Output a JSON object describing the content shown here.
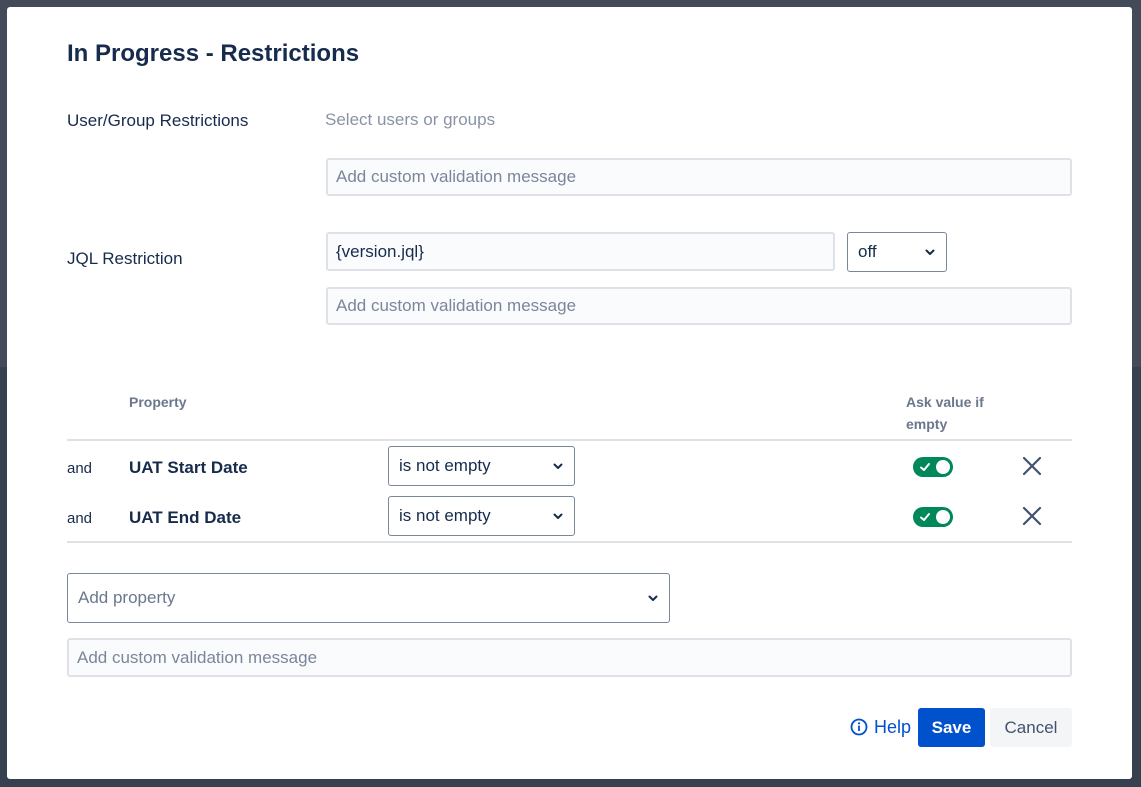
{
  "dialog": {
    "title": "In Progress - Restrictions"
  },
  "user_group": {
    "label": "User/Group Restrictions",
    "placeholder": "Select users or groups",
    "message_placeholder": "Add custom validation message"
  },
  "jql": {
    "label": "JQL Restriction",
    "value": "{version.jql}",
    "mode": "off",
    "message_placeholder": "Add custom validation message"
  },
  "table": {
    "header_property": "Property",
    "header_ask": "Ask value if empty",
    "rows": [
      {
        "connector": "and",
        "property": "UAT Start Date",
        "condition": "is not empty",
        "ask_value": true
      },
      {
        "connector": "and",
        "property": "UAT End Date",
        "condition": "is not empty",
        "ask_value": true
      }
    ]
  },
  "add_property": {
    "placeholder": "Add property",
    "message_placeholder": "Add custom validation message"
  },
  "footer": {
    "help": "Help",
    "save": "Save",
    "cancel": "Cancel"
  },
  "colors": {
    "primary": "#0052cc",
    "toggle_on": "#00875a",
    "text": "#172b4d"
  }
}
